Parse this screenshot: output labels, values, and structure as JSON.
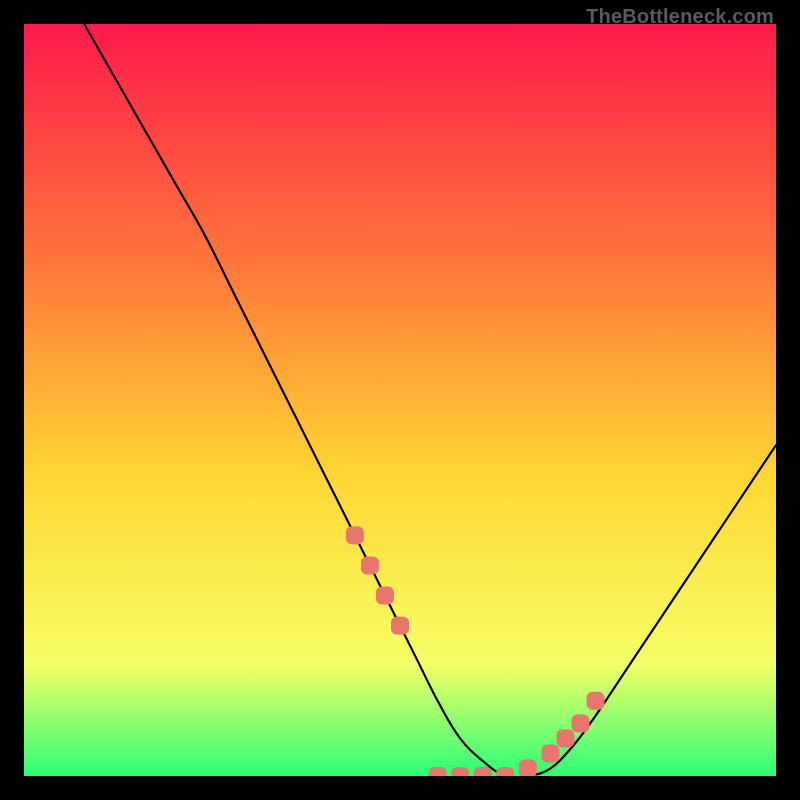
{
  "watermark": "TheBottleneck.com",
  "chart_data": {
    "type": "line",
    "title": "",
    "xlabel": "",
    "ylabel": "",
    "xlim": [
      0,
      100
    ],
    "ylim": [
      0,
      100
    ],
    "x": [
      8,
      12,
      16,
      20,
      24,
      28,
      32,
      36,
      40,
      44,
      48,
      52,
      55,
      58,
      61,
      64,
      67,
      70,
      73,
      76,
      80,
      84,
      88,
      92,
      96,
      100
    ],
    "values": [
      100,
      93,
      86,
      79,
      72,
      64,
      56,
      48,
      40,
      32,
      24,
      16,
      10,
      5,
      2,
      0,
      0,
      1,
      4,
      8,
      14,
      20,
      26,
      32,
      38,
      44
    ],
    "markers": {
      "x": [
        44,
        46,
        48,
        50,
        55,
        58,
        61,
        64,
        67,
        70,
        72,
        74,
        76
      ],
      "values": [
        32,
        28,
        24,
        20,
        0,
        0,
        0,
        0,
        1,
        3,
        5,
        7,
        10
      ]
    },
    "background_gradient": {
      "top": "#ff1a4b",
      "mid1": "#ff7a3a",
      "mid2": "#ffd633",
      "lower": "#f6ff66",
      "bottom": "#2bff76"
    },
    "curve_color": "#000000",
    "marker_color": "#e8766f"
  }
}
